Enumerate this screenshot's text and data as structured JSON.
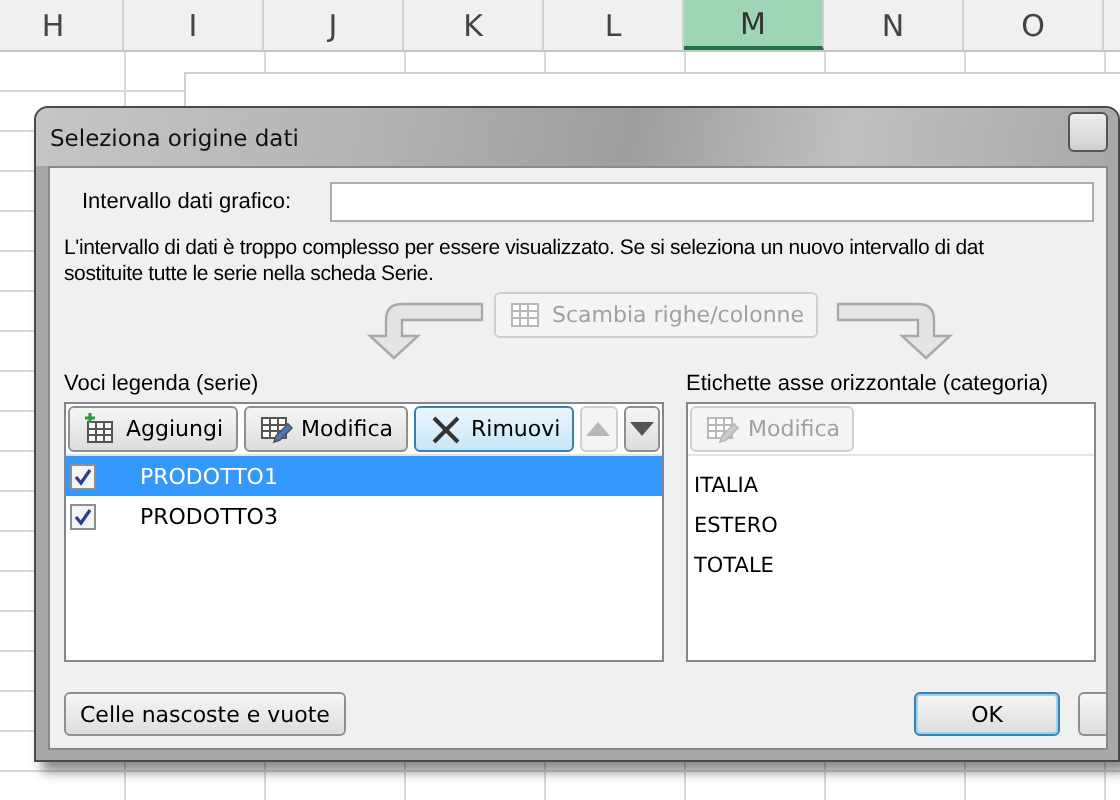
{
  "spreadsheet": {
    "columns": [
      {
        "label": "H",
        "selected": false
      },
      {
        "label": "I",
        "selected": false
      },
      {
        "label": "J",
        "selected": false
      },
      {
        "label": "K",
        "selected": false
      },
      {
        "label": "L",
        "selected": false
      },
      {
        "label": "M",
        "selected": true
      },
      {
        "label": "N",
        "selected": false
      },
      {
        "label": "O",
        "selected": false
      }
    ]
  },
  "dialog": {
    "title": "Seleziona origine dati",
    "range_label": "Intervallo dati grafico:",
    "message_lines": [
      "L'intervallo di dati è troppo complesso per essere visualizzato. Se si seleziona un nuovo intervallo di dat",
      "sostituite tutte le serie nella scheda Serie."
    ],
    "switch_button": {
      "label": "Scambia righe/colonne",
      "disabled": true
    },
    "series_panel": {
      "heading": "Voci legenda (serie)",
      "buttons": [
        {
          "kind": "add",
          "label": "Aggiungi",
          "disabled": false,
          "hovered": false
        },
        {
          "kind": "edit",
          "label": "Modifica",
          "disabled": false,
          "hovered": false
        },
        {
          "kind": "remove",
          "label": "Rimuovi",
          "disabled": false,
          "hovered": true
        },
        {
          "kind": "up",
          "disabled": true,
          "hovered": false
        },
        {
          "kind": "down",
          "disabled": false,
          "hovered": false
        }
      ],
      "items": [
        {
          "label": "PRODOTTO1",
          "checked": true,
          "selected": true
        },
        {
          "label": "PRODOTTO3",
          "checked": true,
          "selected": false
        }
      ]
    },
    "category_panel": {
      "heading": "Etichette asse orizzontale (categoria)",
      "edit_button": {
        "label": "Modifica",
        "disabled": true
      },
      "items": [
        "ITALIA",
        "ESTERO",
        "TOTALE"
      ]
    },
    "footer_buttons": [
      {
        "kind": "hidden_cells",
        "label": "Celle nascoste e vuote",
        "default": false
      },
      {
        "kind": "ok",
        "label": "OK",
        "default": true
      },
      {
        "kind": "other",
        "default": false
      }
    ]
  }
}
